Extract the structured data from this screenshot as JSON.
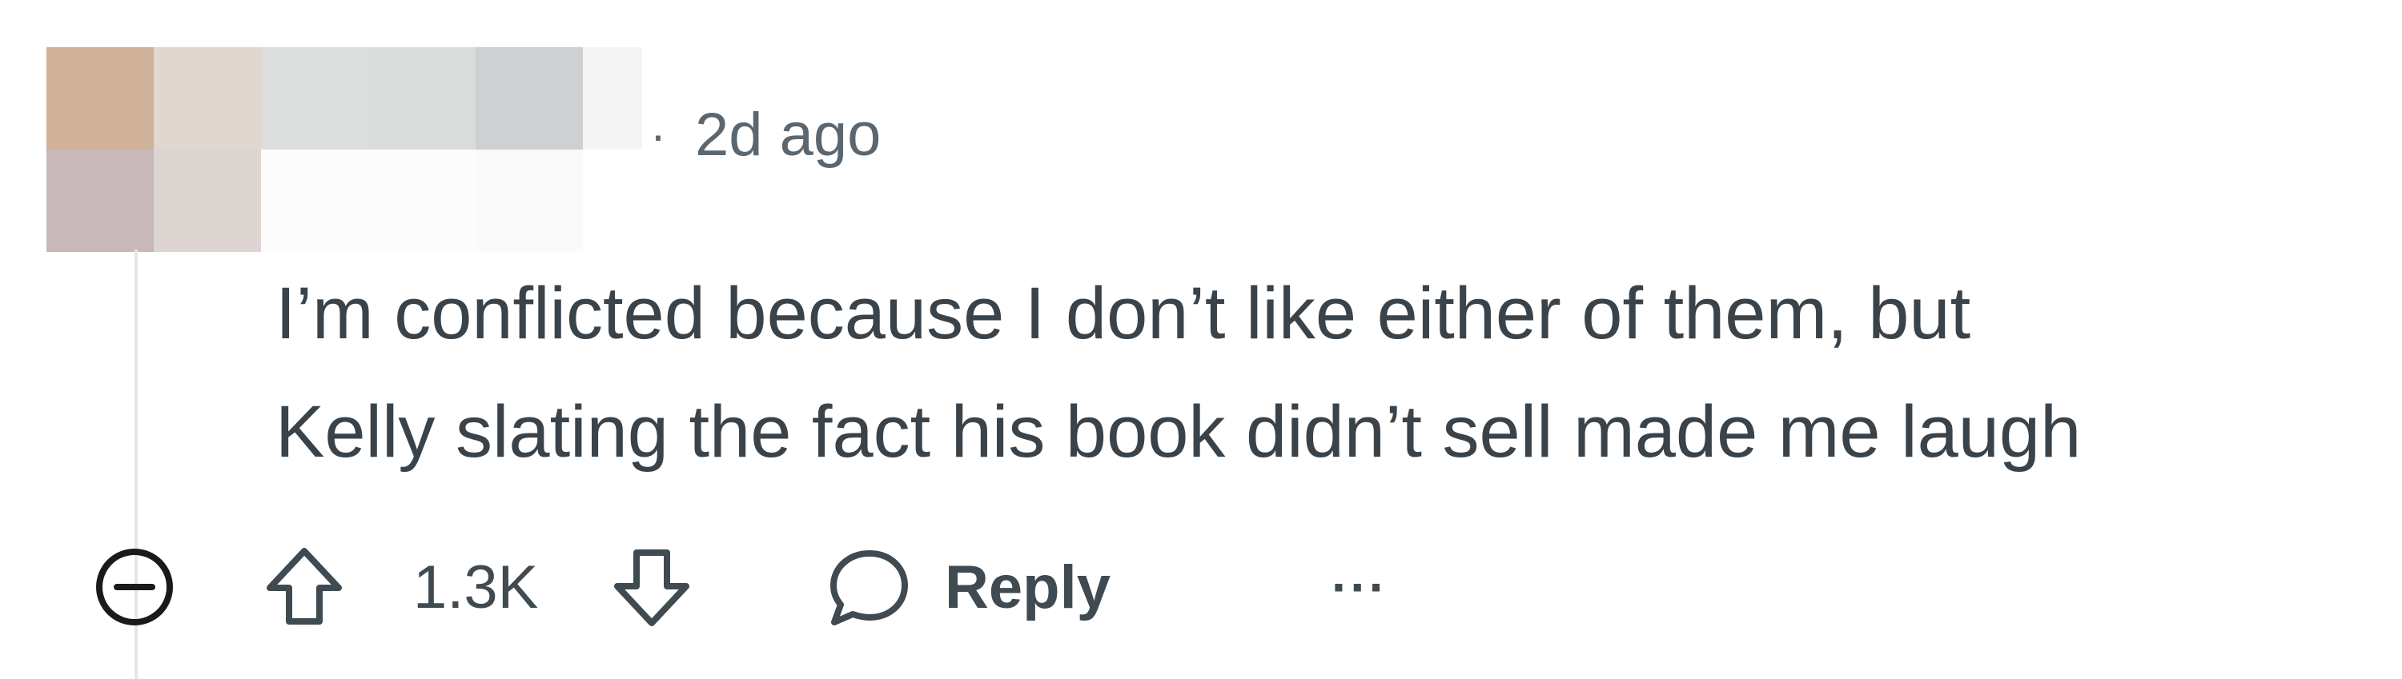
{
  "comment": {
    "separator": "·",
    "timestamp": "2d ago",
    "body_lines": [
      "I’m conflicted because I don’t like either of them, but",
      "Kelly slating the fact his book didn’t sell made me laugh"
    ],
    "votes": "1.3K",
    "reply_label": "Reply",
    "more_label": "···"
  },
  "icons": {
    "collapse": "collapse-thread-icon",
    "upvote": "upvote-arrow-icon",
    "downvote": "downvote-arrow-icon",
    "reply": "speech-bubble-icon",
    "more": "more-options-icon"
  },
  "colors": {
    "text": "#3a434a",
    "meta": "#5b6770",
    "thread_line": "#e4e6e8",
    "background": "#ffffff"
  }
}
